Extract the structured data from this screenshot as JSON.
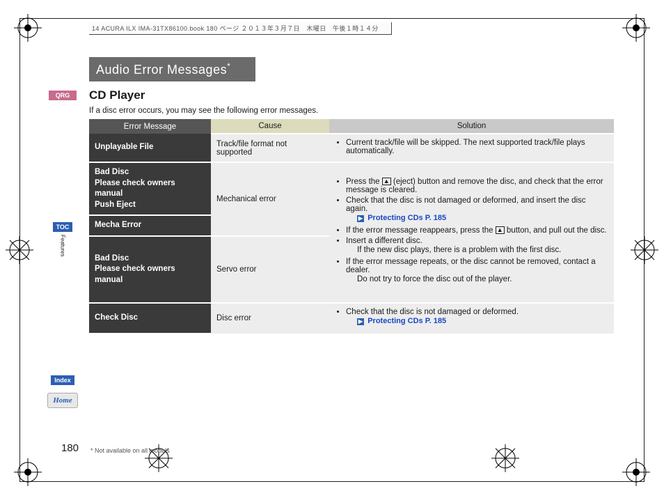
{
  "meta_line": "14 ACURA ILX IMA-31TX86100.book  180 ページ  ２０１３年３月７日　木曜日　午後１時１４分",
  "sidebar": {
    "qrg": "QRG",
    "toc": "TOC",
    "features": "Features",
    "index": "Index",
    "home": "Home"
  },
  "title": "Audio Error Messages",
  "title_ast": "*",
  "subsection": "CD Player",
  "intro": "If a disc error occurs, you may see the following error messages.",
  "headers": {
    "msg": "Error Message",
    "cause": "Cause",
    "solution": "Solution"
  },
  "rows": {
    "r1": {
      "msg": "Unplayable File",
      "cause": "Track/file format not supported",
      "sol1": "Current track/file will be skipped. The next supported track/file plays automatically."
    },
    "r2a": {
      "msg": "Bad Disc\nPlease check owners manual\nPush Eject"
    },
    "r2b": {
      "msg": "Mecha Error"
    },
    "r2": {
      "cause": "Mechanical error",
      "sol1a": "Press the ",
      "sol1b": " (eject) button and remove the disc, and check that the error message is cleared.",
      "sol2": "Check that the disc is not damaged or deformed, and insert the disc again.",
      "xref": "Protecting CDs",
      "xref_p": "P. 185",
      "sol3a": "If the error message reappears, press the ",
      "sol3b": " button, and pull out the disc.",
      "sol4": "Insert a different disc.",
      "sol4a": "If the new disc plays, there is a problem with the first disc.",
      "sol5": "If the error message repeats, or the disc cannot be removed, contact a dealer.",
      "sol5a": "Do not try to force the disc out of the player."
    },
    "r3": {
      "msg": "Bad Disc\nPlease check owners manual",
      "cause": "Servo error"
    },
    "r4": {
      "msg": "Check Disc",
      "cause": "Disc error",
      "sol1": "Check that the disc is not damaged or deformed.",
      "xref": "Protecting CDs",
      "xref_p": "P. 185"
    }
  },
  "page_number": "180",
  "footnote": "* Not available on all models"
}
